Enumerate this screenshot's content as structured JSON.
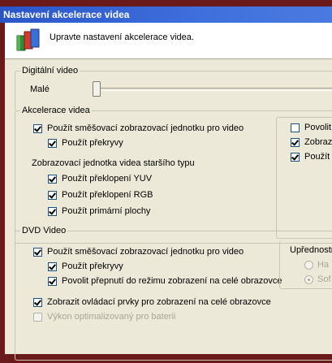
{
  "window": {
    "title": "Nastavení akcelerace videa"
  },
  "header": {
    "description": "Upravte nastavení akcelerace videa."
  },
  "digital_video": {
    "legend": "Digitální video",
    "size_label": "Malé",
    "size_slider_level": 0.0
  },
  "video_acceleration": {
    "legend": "Akcelerace videa",
    "use_mixing_renderer": {
      "label": "Použít směšovací zobrazovací jednotku pro video",
      "checked": true
    },
    "use_overlays": {
      "label": "Použít překryvy",
      "checked": true
    },
    "legacy_renderer_label": "Zobrazovací jednotka videa staršího typu",
    "use_yuv_flipping": {
      "label": "Použít překlopení YUV",
      "checked": true
    },
    "use_rgb_flipping": {
      "label": "Použít překlopení RGB",
      "checked": true
    },
    "use_primary_surfaces": {
      "label": "Použít primární plochy",
      "checked": true
    },
    "right_options": [
      {
        "label": "Povolit",
        "checked": false
      },
      {
        "label": "Zobraz",
        "checked": true
      },
      {
        "label": "Použít",
        "checked": true
      }
    ]
  },
  "dvd_video": {
    "legend": "DVD Video",
    "use_mixing_renderer": {
      "label": "Použít směšovací zobrazovací jednotku pro video",
      "checked": true
    },
    "use_overlays": {
      "label": "Použít překryvy",
      "checked": true
    },
    "fullscreen_switch": {
      "label": "Povolit přepnutí do režimu zobrazení na celé obrazovce",
      "checked": true
    },
    "show_controls": {
      "label": "Zobrazit ovládací prvky pro zobrazení na celé obrazovce",
      "checked": true
    },
    "battery_optimized": {
      "label": "Výkon optimalizovaný pro baterii",
      "checked": false,
      "disabled": true
    },
    "preference": {
      "legend": "Upřednostn",
      "options": [
        {
          "label": "Ha",
          "selected": false
        },
        {
          "label": "Sof",
          "selected": true
        }
      ]
    }
  }
}
